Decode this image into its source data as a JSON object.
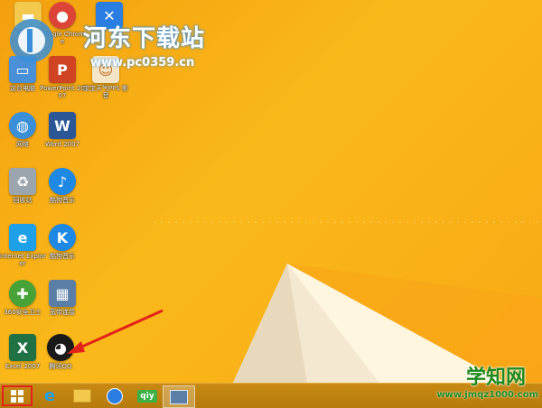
{
  "desktop": {
    "icons": [
      {
        "label": "Adm...",
        "icon": "folder-icon",
        "color": "#f2c94c"
      },
      {
        "label": "Google Chrome",
        "icon": "chrome-icon",
        "color": "#db4437"
      },
      {
        "label": "",
        "icon": "blue-app-icon",
        "color": "#2a7de1"
      },
      {
        "label": "这台电脑",
        "icon": "computer-icon",
        "color": "#4a90d9"
      },
      {
        "label": "PowerPoint 2007",
        "icon": "powerpoint-icon",
        "color": "#d04423"
      },
      {
        "label": "宝宝天气PPS 影音",
        "icon": "baby-app-icon",
        "color": "#f5e6c8"
      },
      {
        "label": "网络",
        "icon": "network-icon",
        "color": "#3a8fd8"
      },
      {
        "label": "Word 2007",
        "icon": "word-icon",
        "color": "#2b5797"
      },
      {
        "label": "回收站",
        "icon": "recycle-bin-icon",
        "color": "#9aa5ad"
      },
      {
        "label": "酷狗音乐",
        "icon": "music-app-icon",
        "color": "#1e88e5"
      },
      {
        "label": "Internet Explorer",
        "icon": "ie-icon",
        "color": "#1ea0e8"
      },
      {
        "label": "酷狗音乐",
        "icon": "kugou-icon",
        "color": "#1e88e5"
      },
      {
        "label": "360安全卫士",
        "icon": "security-360-icon",
        "color": "#47a338"
      },
      {
        "label": "宽带连接",
        "icon": "broadband-icon",
        "color": "#5a7ea6"
      },
      {
        "label": "Excel 2007",
        "icon": "excel-icon",
        "color": "#207245"
      },
      {
        "label": "腾讯QQ",
        "icon": "qq-icon",
        "color": "#1a1a1a"
      }
    ]
  },
  "watermark_top": {
    "title": "河东下载站",
    "url": "www.pc0359.cn"
  },
  "watermark_bottom": {
    "title": "学知网",
    "url": "www.jmqz1000.com"
  },
  "taskbar": {
    "items": [
      {
        "icon": "windows-start-icon"
      },
      {
        "icon": "ie-icon"
      },
      {
        "icon": "file-explorer-icon"
      },
      {
        "icon": "browser-icon"
      },
      {
        "icon": "iqiyi-icon",
        "label": "qiy"
      },
      {
        "icon": "remote-desktop-icon"
      }
    ]
  },
  "colors": {
    "wallpaper": "#f7b012",
    "taskbar": "#c08414",
    "highlight": "#e2231a"
  }
}
